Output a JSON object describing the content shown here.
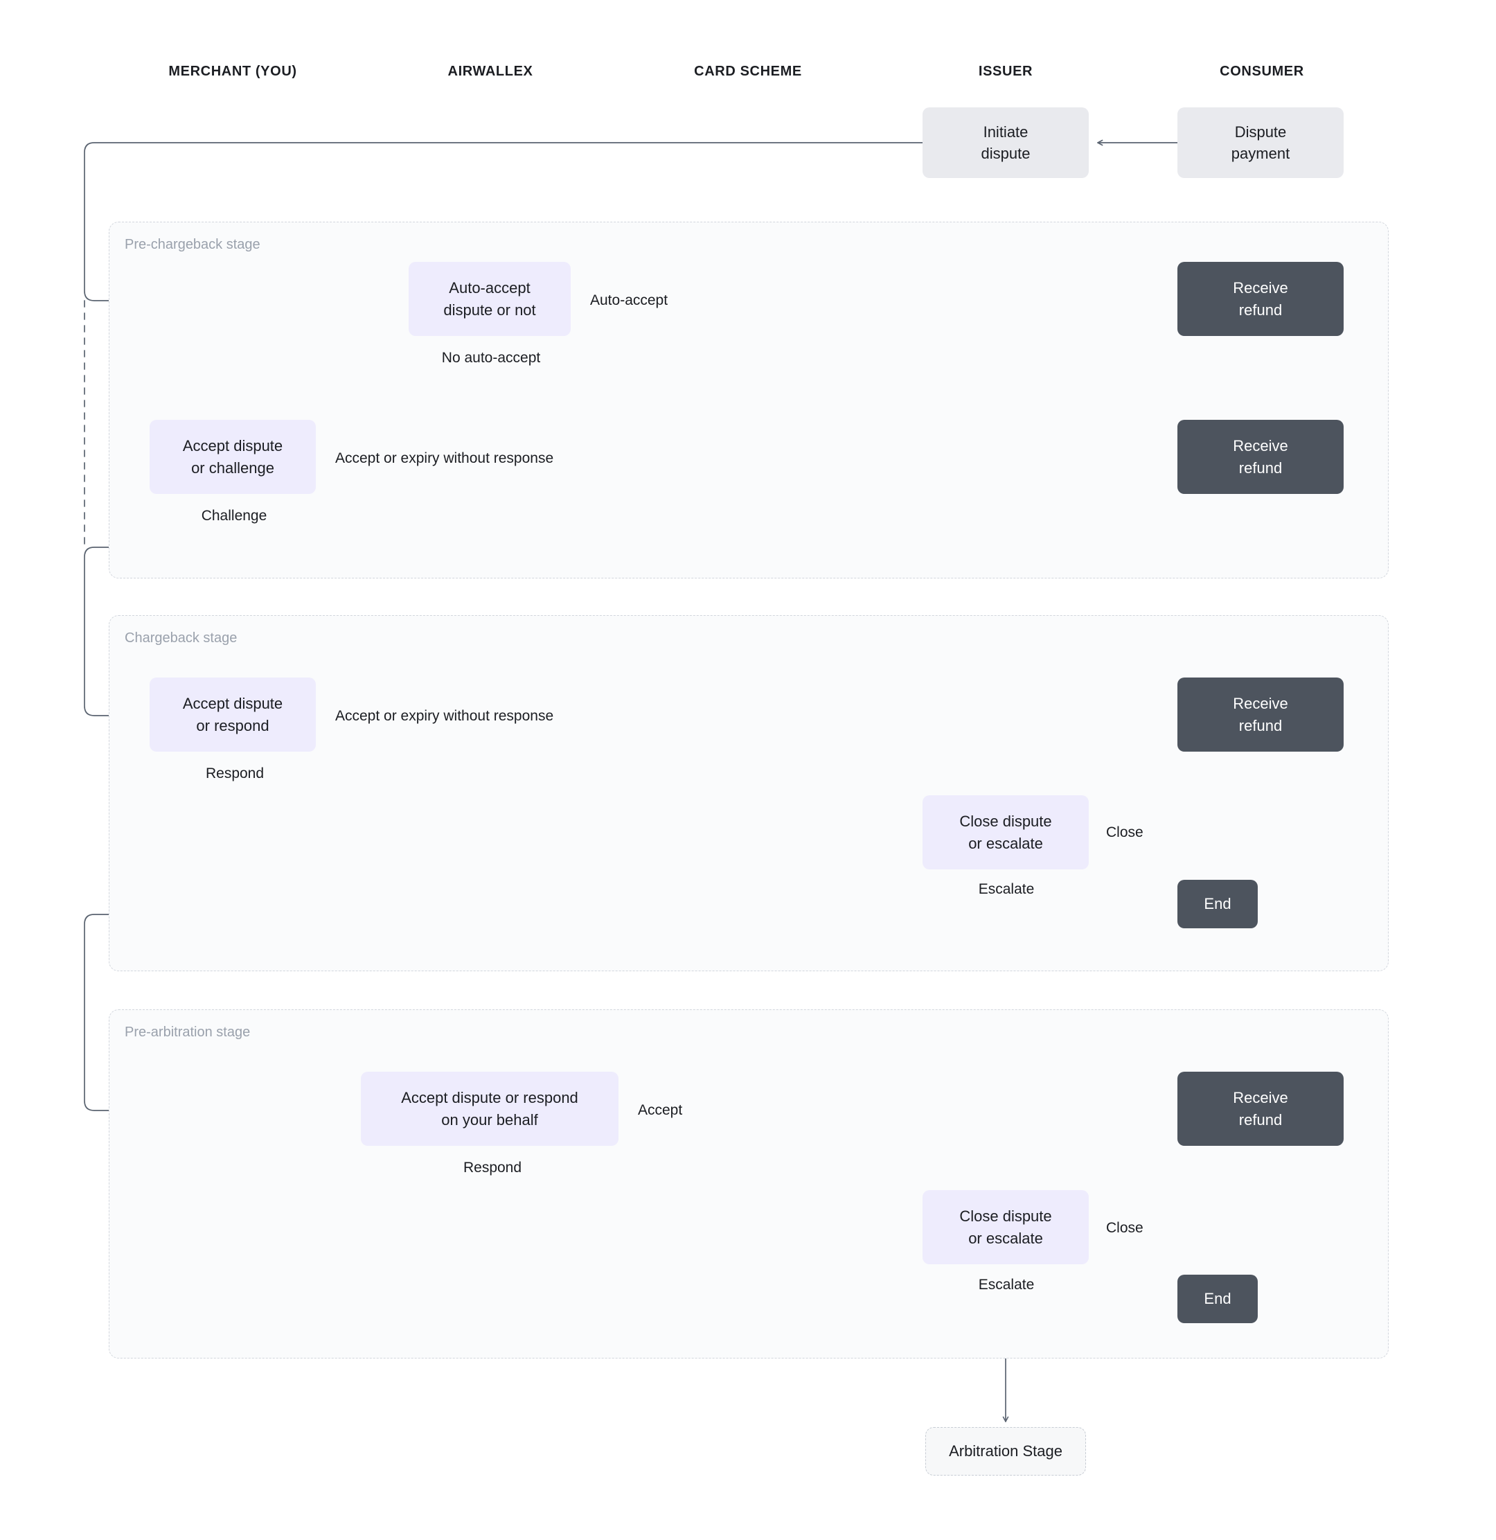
{
  "diagram": {
    "title": "Airwallex dispute lifecycle flow",
    "background": "#ffffff",
    "colors": {
      "grey_node": "#e9eaee",
      "lavender_node": "#eeecfd",
      "dark_node": "#4d545e",
      "stage_border": "#d2d6dd",
      "stage_fill": "#fafbfc",
      "wire": "#5a6370",
      "stage_label_text": "#9aa1ac",
      "node_text": "#1b1d22",
      "dark_node_text": "#ffffff"
    }
  },
  "columns": [
    {
      "label": "MERCHANT (YOU)"
    },
    {
      "label": "AIRWALLEX"
    },
    {
      "label": "CARD SCHEME"
    },
    {
      "label": "ISSUER"
    },
    {
      "label": "CONSUMER"
    }
  ],
  "stages": [
    {
      "label": "Pre-chargeback stage"
    },
    {
      "label": "Chargeback stage"
    },
    {
      "label": "Pre-arbitration stage"
    }
  ],
  "nodes": {
    "initiate_dispute": {
      "line1": "Initiate",
      "line2": "dispute"
    },
    "dispute_payment": {
      "line1": "Dispute",
      "line2": "payment"
    },
    "auto_accept_or_not": {
      "line1": "Auto-accept",
      "line2": "dispute or not"
    },
    "refund_1": {
      "line1": "Receive",
      "line2": "refund"
    },
    "accept_or_challenge": {
      "line1": "Accept dispute",
      "line2": "or challenge"
    },
    "refund_2": {
      "line1": "Receive",
      "line2": "refund"
    },
    "accept_or_respond": {
      "line1": "Accept dispute",
      "line2": "or respond"
    },
    "refund_3": {
      "line1": "Receive",
      "line2": "refund"
    },
    "close_or_escalate_1": {
      "line1": "Close dispute",
      "line2": "or escalate"
    },
    "end_1": {
      "line1": "End"
    },
    "accept_or_respond_behalf": {
      "line1": "Accept dispute or respond",
      "line2": "on your behalf"
    },
    "refund_4": {
      "line1": "Receive",
      "line2": "refund"
    },
    "close_or_escalate_2": {
      "line1": "Close dispute",
      "line2": "or escalate"
    },
    "end_2": {
      "line1": "End"
    },
    "arbitration_stage": {
      "line1": "Arbitration Stage"
    }
  },
  "edge_labels": {
    "auto_accept": "Auto-accept",
    "no_auto_accept": "No auto-accept",
    "accept_or_expiry_1": "Accept or expiry without response",
    "challenge": "Challenge",
    "accept_or_expiry_2": "Accept or expiry without response",
    "respond_1": "Respond",
    "close_1": "Close",
    "escalate_1": "Escalate",
    "accept": "Accept",
    "respond_2": "Respond",
    "close_2": "Close",
    "escalate_2": "Escalate"
  }
}
